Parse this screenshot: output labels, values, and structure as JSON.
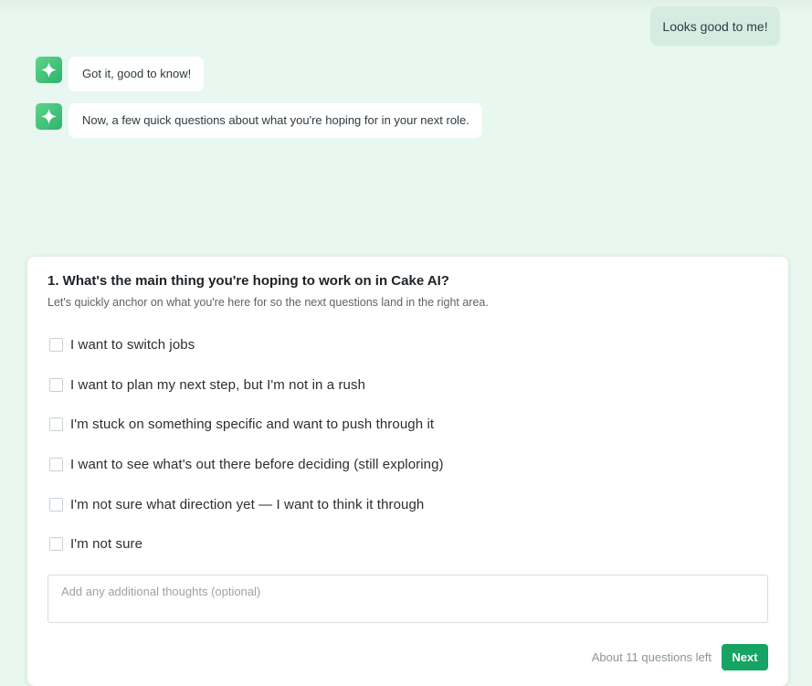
{
  "chat": {
    "user_message": "Looks good to me!",
    "bot_messages": [
      "Got it, good to know!",
      "Now, a few quick questions about what you're hoping for in your next role."
    ]
  },
  "question": {
    "title": "1. What's the main thing you're hoping to work on in Cake AI?",
    "subtitle": "Let's quickly anchor on what you're here for so the next questions land in the right area.",
    "options": [
      "I want to switch jobs",
      "I want to plan my next step, but I'm not in a rush",
      "I'm stuck on something specific and want to push through it",
      "I want to see what's out there before deciding (still exploring)",
      "I'm not sure what direction yet — I want to think it through",
      "I'm not sure"
    ],
    "thoughts_placeholder": "Add any additional thoughts (optional)",
    "remaining_text": "About 11 questions left",
    "next_label": "Next"
  },
  "colors": {
    "background": "#e8f7ef",
    "accent": "#15a463",
    "user_bubble": "#d6ece2"
  },
  "icons": {
    "bot_avatar": "sparkle-icon"
  }
}
